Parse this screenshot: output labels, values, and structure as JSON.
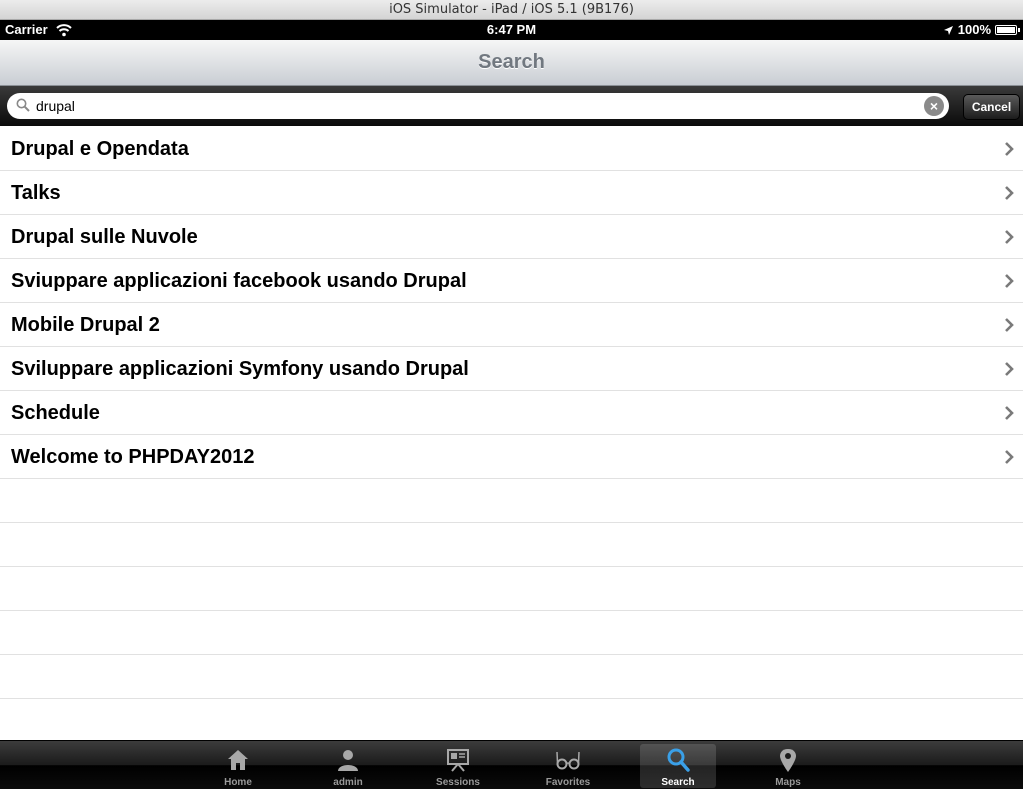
{
  "simulator": {
    "title": "iOS Simulator - iPad / iOS 5.1 (9B176)"
  },
  "status_bar": {
    "carrier": "Carrier",
    "time": "6:47 PM",
    "battery": "100%"
  },
  "navbar": {
    "title": "Search"
  },
  "search": {
    "value": "drupal",
    "cancel_label": "Cancel"
  },
  "results": [
    {
      "label": "Drupal e Opendata"
    },
    {
      "label": "Talks"
    },
    {
      "label": "Drupal sulle Nuvole"
    },
    {
      "label": "Sviuppare applicazioni facebook usando Drupal"
    },
    {
      "label": "Mobile Drupal 2"
    },
    {
      "label": "Sviluppare applicazioni Symfony usando Drupal"
    },
    {
      "label": "Schedule"
    },
    {
      "label": "Welcome to PHPDAY2012"
    }
  ],
  "tabbar": {
    "tabs": [
      {
        "label": "Home",
        "icon": "home-icon"
      },
      {
        "label": "admin",
        "icon": "person-icon"
      },
      {
        "label": "Sessions",
        "icon": "presentation-icon"
      },
      {
        "label": "Favorites",
        "icon": "glasses-icon"
      },
      {
        "label": "Search",
        "icon": "search-icon",
        "active": true
      },
      {
        "label": "Maps",
        "icon": "map-pin-icon"
      }
    ]
  },
  "colors": {
    "active_tab_icon": "#3aa0e8",
    "inactive_tab_icon": "#a8a8a8",
    "nav_title": "#717880"
  }
}
